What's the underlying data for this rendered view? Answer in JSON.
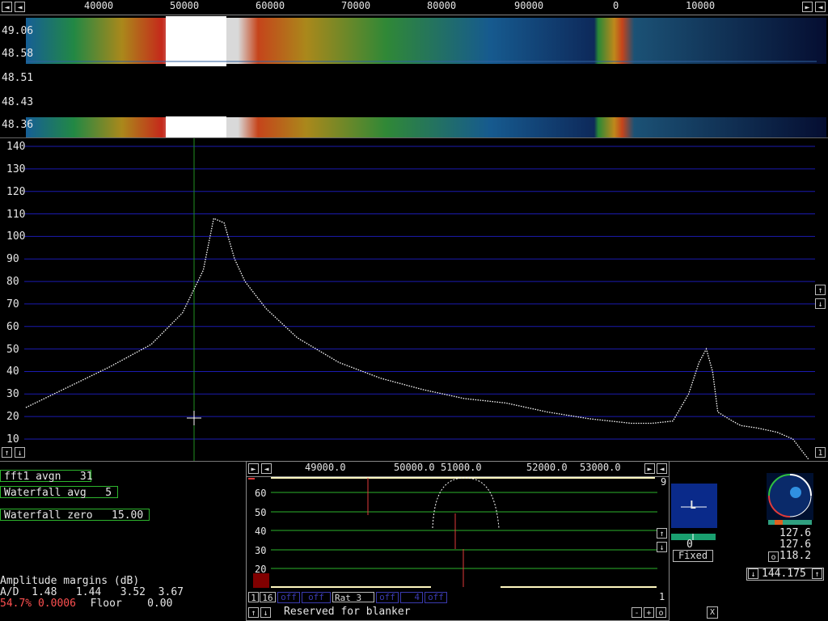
{
  "waterfall": {
    "freq_ticks": [
      "40000",
      "50000",
      "60000",
      "70000",
      "80000",
      "90000",
      "0",
      "10000"
    ],
    "time_labels": [
      "49.06",
      "48.58",
      "48.51",
      "48.43",
      "48.36"
    ]
  },
  "spectrum": {
    "y_ticks": [
      "140",
      "130",
      "120",
      "110",
      "100",
      "90",
      "80",
      "70",
      "60",
      "50",
      "40",
      "30",
      "20",
      "10"
    ]
  },
  "chart_data": {
    "type": "line",
    "xlabel": "",
    "ylabel": "",
    "ylim": [
      0,
      145
    ],
    "x_range_hz": [
      32000,
      107000
    ],
    "series": [
      {
        "x": [
          32000,
          36000,
          40000,
          44000,
          47000,
          49000,
          50000,
          51000,
          52000,
          53000,
          55000,
          58000,
          62000,
          66000,
          70000,
          74000,
          78000,
          82000,
          86000,
          88000,
          90000,
          92000,
          94000,
          95500,
          96500,
          97200,
          97800,
          98300,
          99000,
          99700,
          100500,
          102000,
          104000,
          105500,
          106500,
          107000
        ],
        "y": [
          24,
          33,
          42,
          52,
          66,
          85,
          108,
          106,
          90,
          80,
          68,
          55,
          44,
          37,
          32,
          28,
          26,
          22,
          19,
          18,
          17,
          17,
          18,
          30,
          44,
          50,
          40,
          22,
          20,
          18,
          16,
          15,
          13,
          10,
          4,
          1
        ]
      }
    ]
  },
  "left_panel": {
    "fft1_avgn": "fft1 avgn   31",
    "waterfall_avg": "Waterfall avg   5",
    "waterfall_zero": "Waterfall zero   15.00",
    "amp_title": "Amplitude margins (dB)",
    "ad_line": "A/D  1.48   1.44   3.52  3.67",
    "red_value": "54.7% 0.0006",
    "floor_line": "  Floor    0.00"
  },
  "baseband": {
    "freq_ticks": [
      "49000.0",
      "50000.0",
      "51000.0",
      "52000.0",
      "53000.0"
    ],
    "y_ticks": [
      "60",
      "50",
      "40",
      "30",
      "20"
    ],
    "right_num": "9",
    "right_num_bottom": "1",
    "btn_1": "1",
    "btn_16": "16",
    "off_label": "off",
    "rat_label": "Rat   3",
    "four_label": "4",
    "reserved": "Reserved for blanker"
  },
  "smeter": {
    "letter": "L",
    "value": "0",
    "mode": "Fixed"
  },
  "polar": {
    "v1": "127.6",
    "v2": "127.6",
    "o_label": "o",
    "v3": "118.2",
    "freq": "144.175"
  },
  "icons": {
    "left": "◄",
    "right": "►",
    "up": "↑",
    "down": "↓",
    "close": "X",
    "minus": "-",
    "plus": "+",
    "zero": "o"
  },
  "colors": {
    "grid": "#1b1bb0",
    "trace": "#ffffff",
    "green": "#2db52d",
    "red": "#e03a3a",
    "cursor": "#1f8f1f"
  }
}
